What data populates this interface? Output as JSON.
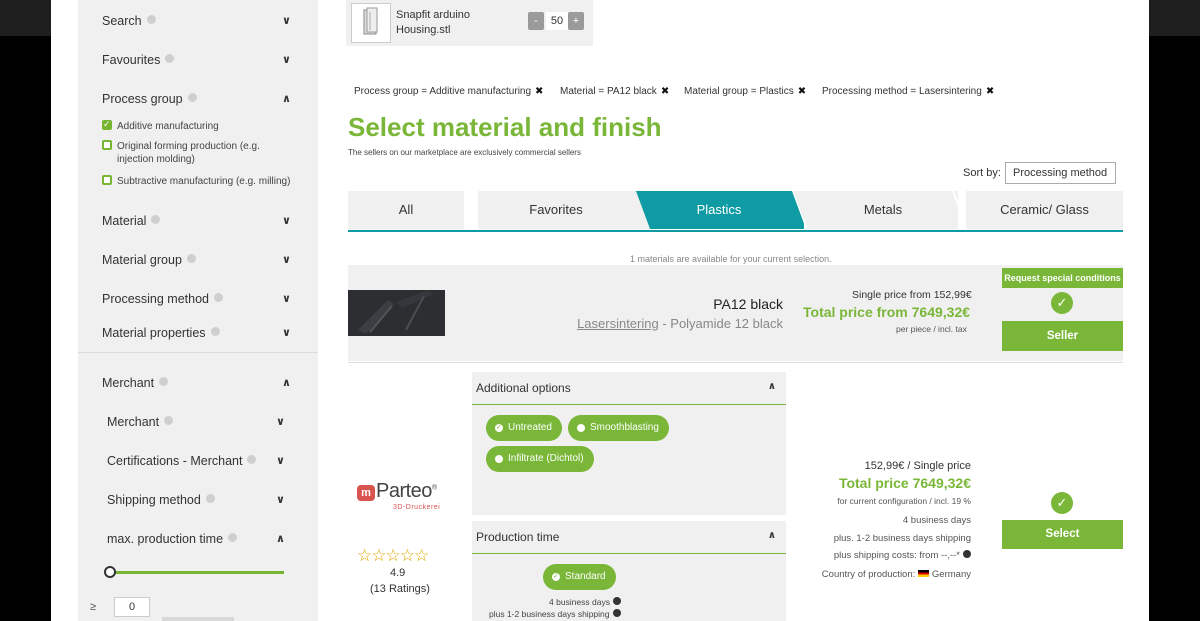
{
  "sidebar": {
    "search": "Search",
    "favourites": "Favourites",
    "process_group": "Process group",
    "process_options": [
      {
        "label": "Additive manufacturing",
        "checked": true
      },
      {
        "label": "Original forming production (e.g. injection molding)",
        "checked": false
      },
      {
        "label": "Subtractive manufacturing (e.g. milling)",
        "checked": false
      }
    ],
    "material": "Material",
    "material_group": "Material group",
    "processing_method": "Processing method",
    "material_properties": "Material properties",
    "merchant_section": "Merchant",
    "merchant": "Merchant",
    "certifications": "Certifications - Merchant",
    "shipping_method": "Shipping method",
    "max_production_time": "max. production time",
    "min_prefix": "≥",
    "min_value": "0"
  },
  "file": {
    "name": "Snapfit arduino Housing.stl",
    "minus": "-",
    "plus": "+",
    "quantity": "50"
  },
  "filters": [
    "Process group = Additive manufacturing",
    "Material = PA12 black",
    "Material group = Plastics",
    "Processing method = Lasersintering"
  ],
  "filter_remove": "✖",
  "title": "Select material and finish",
  "subtitle": "The sellers on our marketplace are exclusively commercial sellers",
  "sort": {
    "label": "Sort by:",
    "value": "Processing method"
  },
  "tabs": [
    "All",
    "Favorites",
    "Plastics",
    "Metals",
    "Ceramic/ Glass"
  ],
  "active_tab": "Plastics",
  "availability": "1 materials are available for your current selection.",
  "material_row": {
    "name": "PA12 black",
    "process_link": "Lasersintering",
    "sub_suffix": " - Polyamide 12 black",
    "single_price": "Single price from 152,99€",
    "total_price": "Total price from 7649,32€",
    "price_note": "per piece / incl. tax",
    "special_btn": "Request special conditions",
    "seller_btn": "Seller"
  },
  "options": {
    "header": "Additional options",
    "pills": [
      {
        "label": "Untreated",
        "checked": true
      },
      {
        "label": "Smoothblasting",
        "checked": false
      },
      {
        "label": "Infiltrate (Dichtol)",
        "checked": false
      }
    ]
  },
  "production": {
    "header": "Production time",
    "standard": "Standard",
    "days": "4 business days",
    "shipping": "plus 1-2 business days shipping"
  },
  "merchant": {
    "logo_name": "Parteo",
    "logo_icon": "m",
    "logo_registered": "®",
    "logo_sub": "3D-Druckerei",
    "stars": "☆☆☆☆☆",
    "rating": "4.9",
    "rating_count": "(13 Ratings)"
  },
  "offer": {
    "single_price": "152,99€ / Single price",
    "total_price": "Total price 7649,32€",
    "config_note": "for current configuration / incl. 19 %",
    "business_days": "4 business days",
    "shipping_days": "plus. 1-2 business days shipping",
    "shipping_costs": "plus shipping costs: from --,--*",
    "country_label": "Country of production:",
    "country": "Germany",
    "select_btn": "Select"
  },
  "colors": {
    "accent": "#7ab738",
    "teal": "#0f9ba3",
    "panel": "#f0f0f0"
  }
}
